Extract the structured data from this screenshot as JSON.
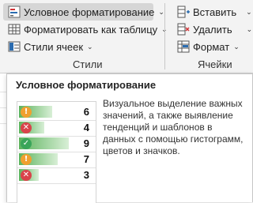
{
  "ribbon": {
    "styles_group": {
      "conditional_formatting": "Условное форматирование",
      "format_as_table": "Форматировать как таблицу",
      "cell_styles": "Стили ячеек",
      "label": "Стили"
    },
    "cells_group": {
      "insert": "Вставить",
      "delete": "Удалить",
      "format": "Формат",
      "label": "Ячейки"
    }
  },
  "tooltip": {
    "title": "Условное форматирование",
    "description": "Визуальное выделение важных значений, а также выявление тенденций и шаблонов в данных с помощью гистограмм, цветов и значков.",
    "preview_rows": [
      {
        "value": "6",
        "icon": "warning-icon",
        "icon_color": "#f0a030",
        "glyph": "!",
        "bar_fraction": 0.6
      },
      {
        "value": "4",
        "icon": "x-circle-icon",
        "icon_color": "#d9434b",
        "glyph": "✕",
        "bar_fraction": 0.45
      },
      {
        "value": "9",
        "icon": "check-circle-icon",
        "icon_color": "#3aa55a",
        "glyph": "✓",
        "bar_fraction": 0.9
      },
      {
        "value": "7",
        "icon": "warning-icon",
        "icon_color": "#f0a030",
        "glyph": "!",
        "bar_fraction": 0.7
      },
      {
        "value": "3",
        "icon": "x-circle-icon",
        "icon_color": "#d9434b",
        "glyph": "✕",
        "bar_fraction": 0.35
      }
    ]
  }
}
